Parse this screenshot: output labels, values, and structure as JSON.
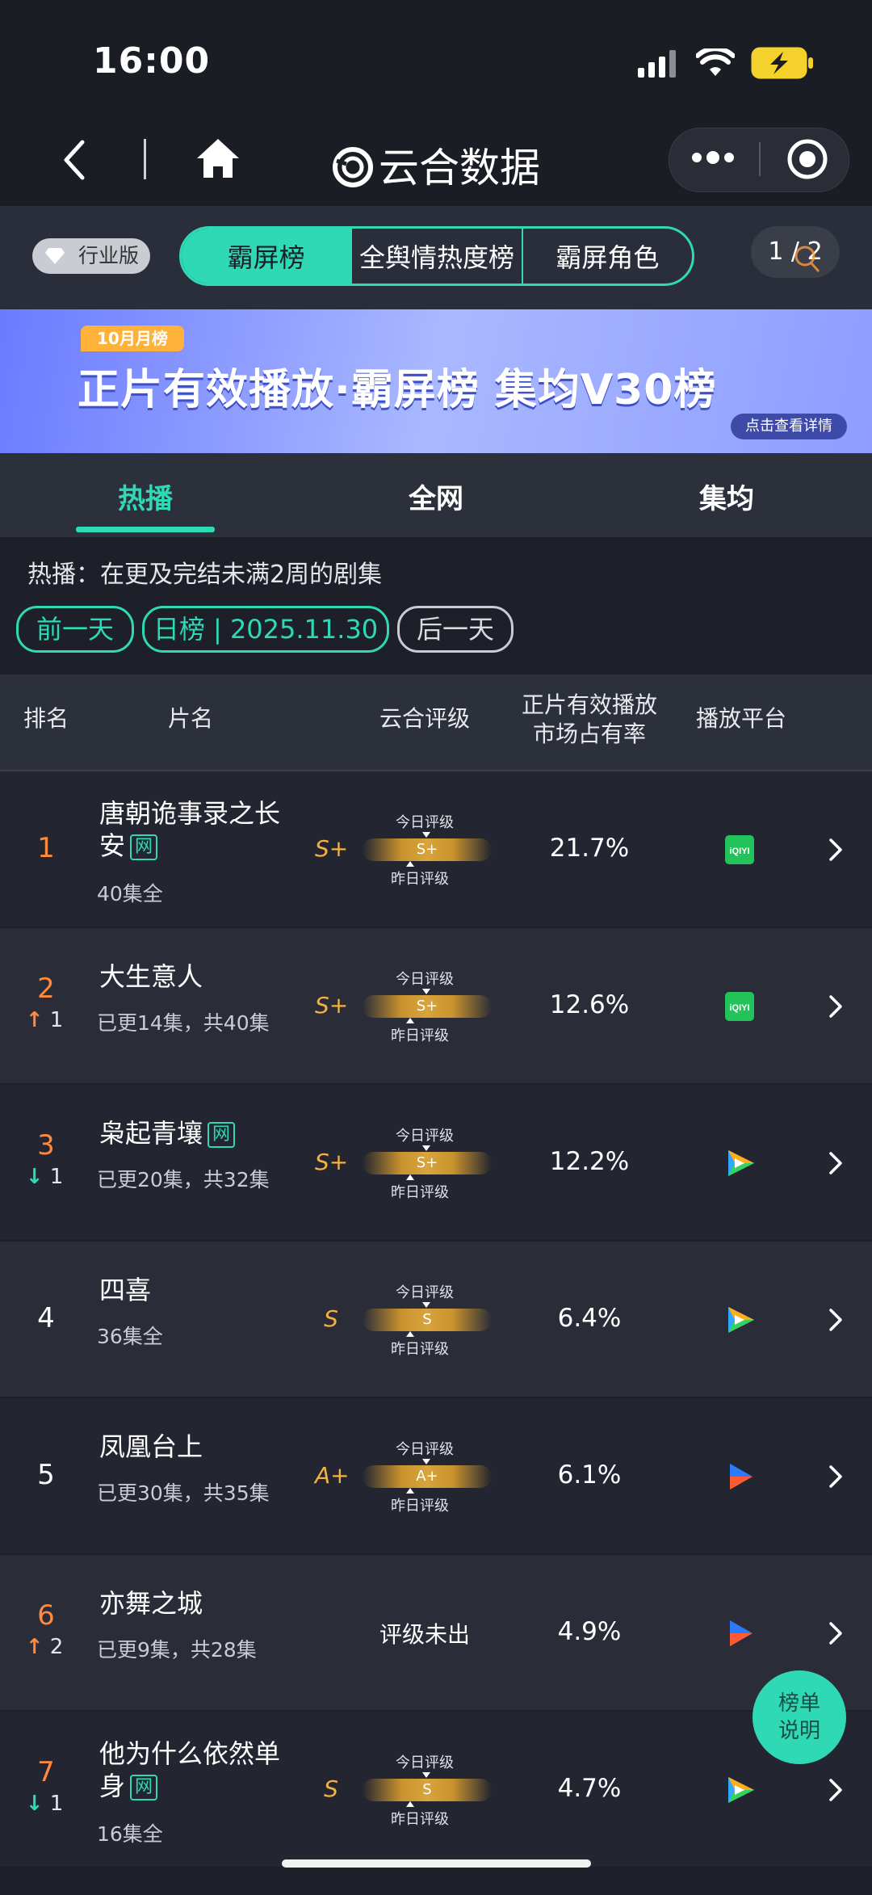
{
  "status_bar": {
    "time": "16:00"
  },
  "nav": {
    "title": "云合数据"
  },
  "filter": {
    "edition": "行业版",
    "segments": [
      "霸屏榜",
      "全舆情热度榜",
      "霸屏角色"
    ],
    "pager": "1 / 2"
  },
  "banner": {
    "month_tag": "10月月榜",
    "title": "正片有效播放·霸屏榜 集均V30榜",
    "detail": "点击查看详情"
  },
  "subtabs": [
    "热播",
    "全网",
    "集均"
  ],
  "info": "热播：在更及完结未满2周的剧集",
  "date_nav": {
    "prev": "前一天",
    "current": "日榜 | 2025.11.30",
    "next": "后一天"
  },
  "table": {
    "headers": [
      "排名",
      "片名",
      "云合评级",
      "正片有效播放\n市场占有率",
      "播放平台"
    ],
    "today_label": "今日评级",
    "yesterday_label": "昨日评级",
    "rows": [
      {
        "rank": "1",
        "trend": "",
        "trend_value": "",
        "name": "唐朝诡事录之长安",
        "net": "网",
        "episodes": "40集全",
        "grade": "S+",
        "grade_bar": "S+",
        "share": "21.7%",
        "platform": "iqiyi"
      },
      {
        "rank": "2",
        "trend": "up",
        "trend_value": "1",
        "name": "大生意人",
        "net": "",
        "episodes": "已更14集，共40集",
        "grade": "S+",
        "grade_bar": "S+",
        "share": "12.6%",
        "platform": "iqiyi"
      },
      {
        "rank": "3",
        "trend": "down",
        "trend_value": "1",
        "name": "枭起青壤",
        "net": "网",
        "episodes": "已更20集，共32集",
        "grade": "S+",
        "grade_bar": "S+",
        "share": "12.2%",
        "platform": "tencent"
      },
      {
        "rank": "4",
        "trend": "",
        "trend_value": "",
        "name": "四喜",
        "net": "",
        "episodes": "36集全",
        "grade": "S",
        "grade_bar": "S",
        "share": "6.4%",
        "platform": "tencent"
      },
      {
        "rank": "5",
        "trend": "",
        "trend_value": "",
        "name": "凤凰台上",
        "net": "",
        "episodes": "已更30集，共35集",
        "grade": "A+",
        "grade_bar": "A+",
        "share": "6.1%",
        "platform": "youku"
      },
      {
        "rank": "6",
        "trend": "up",
        "trend_value": "2",
        "name": "亦舞之城",
        "net": "",
        "episodes": "已更9集，共28集",
        "grade": "",
        "grade_bar": "",
        "no_grade": "评级未出",
        "share": "4.9%",
        "platform": "youku"
      },
      {
        "rank": "7",
        "trend": "down",
        "trend_value": "1",
        "name": "他为什么依然单身",
        "net": "网",
        "episodes": "16集全",
        "grade": "S",
        "grade_bar": "S",
        "share": "4.7%",
        "platform": "tencent"
      }
    ]
  },
  "fab": {
    "label": "榜单说明"
  },
  "colors": {
    "accent": "#2fd9b5",
    "background": "#1d2029",
    "grade": "#f5b043",
    "up": "#ff8a3d"
  },
  "icons": {
    "back": "back-arrow-icon",
    "home": "home-icon",
    "logo": "yunhe-logo-icon",
    "more": "more-dots-icon",
    "close": "target-close-icon",
    "search": "search-icon",
    "diamond": "diamond-icon"
  }
}
